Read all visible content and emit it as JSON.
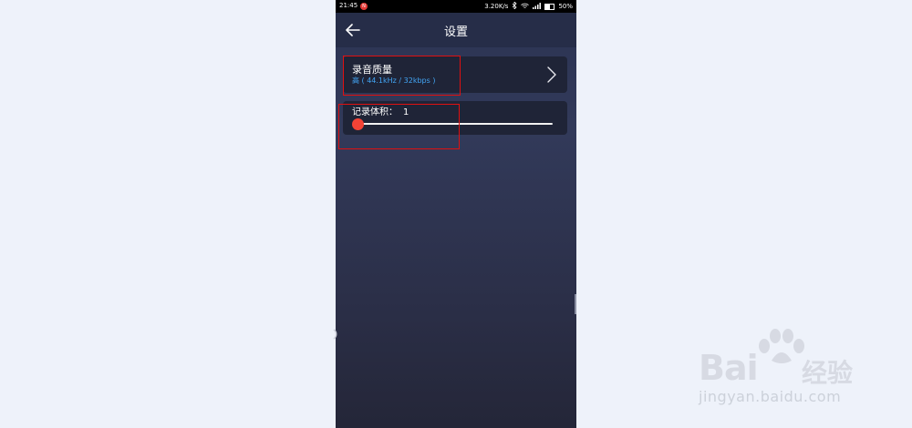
{
  "status_bar": {
    "time": "21:45",
    "notification_badge": "N",
    "network_speed": "3.20K/s",
    "icons": [
      "bluetooth-icon",
      "wifi-icon",
      "signal-icon"
    ],
    "battery": "50%"
  },
  "header": {
    "back_icon": "back-arrow-icon",
    "title": "设置"
  },
  "settings": {
    "quality": {
      "label": "录音质量",
      "value": "高 ( 44.1kHz / 32kbps )",
      "chevron": "chevron-right-icon"
    },
    "volume": {
      "label": "记录体积：",
      "value": "1",
      "slider_fraction": 0.0
    }
  },
  "watermark": {
    "brand": "Bai",
    "brand_cn": "经验",
    "url": "jingyan.baidu.com"
  },
  "colors": {
    "accent_value": "#42a5f5",
    "slider_thumb": "#f44336",
    "highlight_box": "#e01010"
  }
}
